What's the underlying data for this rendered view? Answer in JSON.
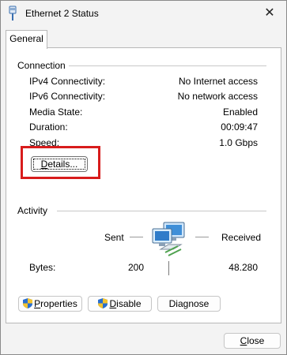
{
  "window": {
    "title": "Ethernet 2 Status",
    "close_glyph": "✕"
  },
  "tab": {
    "label": "General"
  },
  "connection": {
    "title": "Connection",
    "rows": [
      {
        "label": "IPv4 Connectivity:",
        "value": "No Internet access"
      },
      {
        "label": "IPv6 Connectivity:",
        "value": "No network access"
      },
      {
        "label": "Media State:",
        "value": "Enabled"
      },
      {
        "label": "Duration:",
        "value": "00:09:47"
      },
      {
        "label": "Speed:",
        "value": "1.0 Gbps"
      }
    ],
    "details_label_accel": "D",
    "details_label_rest": "etails..."
  },
  "activity": {
    "title": "Activity",
    "sent_label": "Sent",
    "received_label": "Received",
    "bytes_label": "Bytes:",
    "bytes_sent": "200",
    "bytes_received": "48.280"
  },
  "buttons": {
    "properties_accel": "P",
    "properties_rest": "roperties",
    "disable_accel": "D",
    "disable_rest": "isable",
    "diagnose": "Diagnose",
    "close_accel": "C",
    "close_rest": "lose"
  },
  "colors": {
    "highlight": "#d81c1c"
  },
  "icons": {
    "title": "ethernet-plug-icon",
    "network": "network-computers-icon",
    "shield": "uac-shield-icon"
  }
}
